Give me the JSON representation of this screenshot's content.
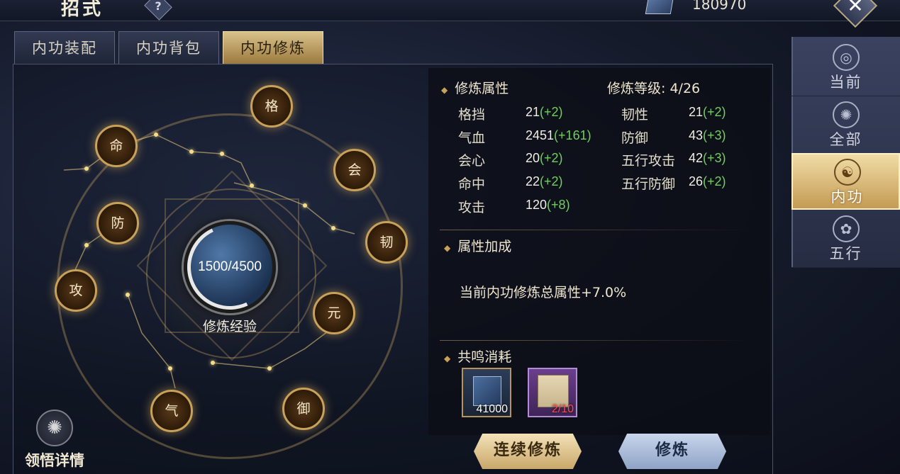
{
  "header": {
    "title": "招式",
    "help_label": "?",
    "currency_value": "180970",
    "close_label": "✕"
  },
  "tabs": [
    {
      "label": "内功装配",
      "active": false
    },
    {
      "label": "内功背包",
      "active": false
    },
    {
      "label": "内功修炼",
      "active": true
    }
  ],
  "wheel": {
    "progress_text": "1500/4500",
    "progress_fraction": 0.333,
    "progress_label": "修炼经验",
    "nodes": [
      "格",
      "会",
      "韧",
      "元",
      "御",
      "气",
      "攻",
      "防",
      "命"
    ]
  },
  "insight": {
    "icon": "triskelion-icon",
    "label": "领悟详情"
  },
  "cultivation": {
    "title": "修炼属性",
    "level_label": "修炼等级:",
    "level_value": "4/26",
    "stats_left": [
      {
        "name": "格挡",
        "base": "21",
        "inc": "(+2)"
      },
      {
        "name": "气血",
        "base": "2451",
        "inc": "(+161)"
      },
      {
        "name": "会心",
        "base": "20",
        "inc": "(+2)"
      },
      {
        "name": "命中",
        "base": "22",
        "inc": "(+2)"
      },
      {
        "name": "攻击",
        "base": "120",
        "inc": "(+8)"
      }
    ],
    "stats_right": [
      {
        "name": "韧性",
        "base": "21",
        "inc": "(+2)"
      },
      {
        "name": "防御",
        "base": "43",
        "inc": "(+3)"
      },
      {
        "name": "五行攻击",
        "base": "42",
        "inc": "(+3)"
      },
      {
        "name": "五行防御",
        "base": "26",
        "inc": "(+2)"
      }
    ]
  },
  "bonus": {
    "title": "属性加成",
    "text": "当前内功修炼总属性+7.0%"
  },
  "cost": {
    "title": "共鸣消耗",
    "items": [
      {
        "icon": "blue-book-icon",
        "count": "41000"
      },
      {
        "icon": "scroll-icon",
        "count": "2/10"
      }
    ]
  },
  "buttons": {
    "continuous": "连续修炼",
    "cultivate": "修炼"
  },
  "side_tabs": [
    {
      "label": "当前",
      "icon": "swirl-icon",
      "active": false
    },
    {
      "label": "全部",
      "icon": "vortex-icon",
      "active": false
    },
    {
      "label": "内功",
      "icon": "meditation-icon",
      "active": true
    },
    {
      "label": "五行",
      "icon": "five-elements-icon",
      "active": false
    }
  ],
  "colors": {
    "accent_gold": "#c9a25a",
    "increase_green": "#6fd05a",
    "cost_short_red": "#ff4a4a"
  }
}
